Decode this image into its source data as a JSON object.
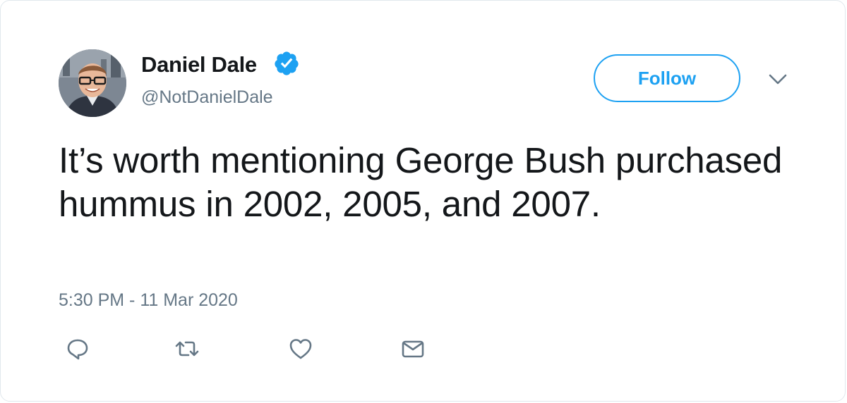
{
  "user": {
    "name": "Daniel Dale",
    "handle": "@NotDanielDale",
    "verified": true,
    "avatar_icon": "profile-photo"
  },
  "follow_button": {
    "label": "Follow"
  },
  "menu": {
    "icon": "chevron-down-icon"
  },
  "tweet": {
    "text": "It’s worth mentioning George Bush purchased hummus in 2002, 2005, and 2007.",
    "timestamp": "5:30 PM - 11 Mar 2020"
  },
  "actions": [
    {
      "name": "reply",
      "icon": "reply-icon"
    },
    {
      "name": "retweet",
      "icon": "retweet-icon"
    },
    {
      "name": "like",
      "icon": "heart-icon"
    },
    {
      "name": "direct-message",
      "icon": "envelope-icon"
    }
  ],
  "colors": {
    "accent": "#1da1f2",
    "text": "#14171a",
    "secondary": "#657786",
    "border": "#e1e8ed"
  }
}
